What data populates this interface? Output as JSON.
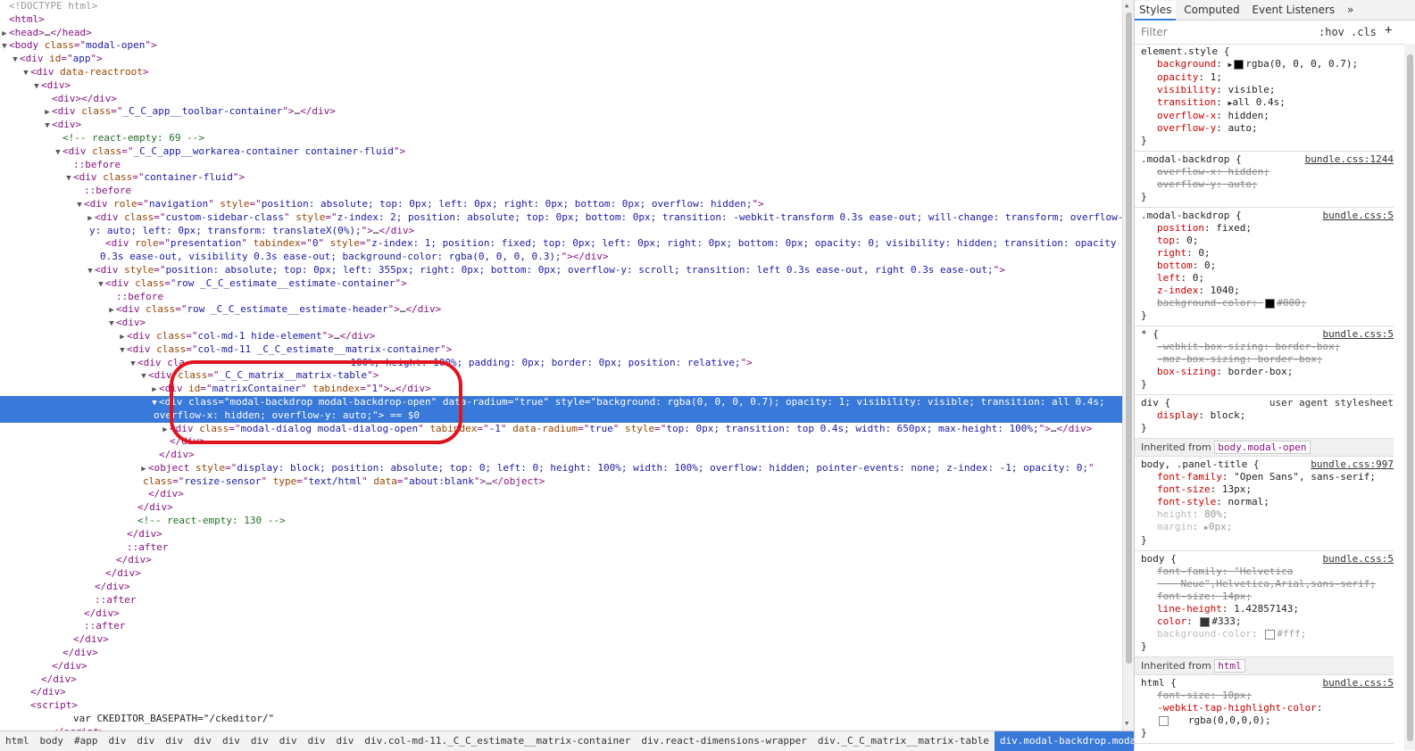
{
  "dom_lines": [
    {
      "indent": 0,
      "tri": "",
      "html": "<span class='dim'>&lt;!DOCTYPE html&gt;</span>"
    },
    {
      "indent": 0,
      "tri": "",
      "html": "<span class='tag'>&lt;html&gt;</span>"
    },
    {
      "indent": 0,
      "tri": "▶",
      "html": "<span class='tag'>&lt;head&gt;</span>…<span class='tag'>&lt;/head&gt;</span>"
    },
    {
      "indent": 0,
      "tri": "▼",
      "html": "<span class='tag'>&lt;body </span><span class='attr'>class</span><span class='tag'>=\"</span><span class='val'>modal-open</span><span class='tag'>\"&gt;</span>"
    },
    {
      "indent": 1,
      "tri": "▼",
      "html": "<span class='tag'>&lt;div </span><span class='attr'>id</span><span class='tag'>=\"</span><span class='val'>app</span><span class='tag'>\"&gt;</span>"
    },
    {
      "indent": 2,
      "tri": "▼",
      "html": "<span class='tag'>&lt;div </span><span class='attr'>data-reactroot</span><span class='tag'>&gt;</span>"
    },
    {
      "indent": 3,
      "tri": "▼",
      "html": "<span class='tag'>&lt;div&gt;</span>"
    },
    {
      "indent": 4,
      "tri": "",
      "html": "<span class='tag'>&lt;div&gt;&lt;/div&gt;</span>"
    },
    {
      "indent": 4,
      "tri": "▶",
      "html": "<span class='tag'>&lt;div </span><span class='attr'>class</span><span class='tag'>=\"</span><span class='val'>_C_C_app__toolbar-container</span><span class='tag'>\"&gt;</span>…<span class='tag'>&lt;/div&gt;</span>"
    },
    {
      "indent": 4,
      "tri": "▼",
      "html": "<span class='tag'>&lt;div&gt;</span>"
    },
    {
      "indent": 5,
      "tri": "",
      "html": "<span class='cmt'>&lt;!-- react-empty: 69 --&gt;</span>"
    },
    {
      "indent": 5,
      "tri": "▼",
      "html": "<span class='tag'>&lt;div </span><span class='attr'>class</span><span class='tag'>=\"</span><span class='val'>_C_C_app__workarea-container container-fluid</span><span class='tag'>\"&gt;</span>"
    },
    {
      "indent": 6,
      "tri": "",
      "html": "<span class='pseudo'>::before</span>"
    },
    {
      "indent": 6,
      "tri": "▼",
      "html": "<span class='tag'>&lt;div </span><span class='attr'>class</span><span class='tag'>=\"</span><span class='val'>container-fluid</span><span class='tag'>\"&gt;</span>"
    },
    {
      "indent": 7,
      "tri": "",
      "html": "<span class='pseudo'>::before</span>"
    },
    {
      "indent": 7,
      "tri": "▼",
      "html": "<span class='tag'>&lt;div </span><span class='attr'>role</span><span class='tag'>=\"</span><span class='val'>navigation</span><span class='tag'>\" </span><span class='attr'>style</span><span class='tag'>=\"</span><span class='val'>position: absolute; top: 0px; left: 0px; right: 0px; bottom: 0px; overflow: hidden;</span><span class='tag'>\"&gt;</span>"
    },
    {
      "indent": 8,
      "tri": "▶",
      "html": "<span class='tag'>&lt;div </span><span class='attr'>class</span><span class='tag'>=\"</span><span class='val'>custom-sidebar-class</span><span class='tag'>\" </span><span class='attr'>style</span><span class='tag'>=\"</span><span class='val'>z-index: 2; position: absolute; top: 0px; bottom: 0px; transition: -webkit-transform 0.3s ease-out; will-change: transform; overflow-</span>"
    },
    {
      "indent": 8,
      "tri": "",
      "cont": true,
      "html": "<span class='val'>y: auto; left: 0px; transform: translateX(0%);</span><span class='tag'>\"&gt;</span>…<span class='tag'>&lt;/div&gt;</span>"
    },
    {
      "indent": 9,
      "tri": "",
      "html": "<span class='tag'>&lt;div </span><span class='attr'>role</span><span class='tag'>=\"</span><span class='val'>presentation</span><span class='tag'>\" </span><span class='attr'>tabindex</span><span class='tag'>=\"</span><span class='val'>0</span><span class='tag'>\" </span><span class='attr'>style</span><span class='tag'>=\"</span><span class='val'>z-index: 1; position: fixed; top: 0px; left: 0px; right: 0px; bottom: 0px; opacity: 0; visibility: hidden; transition: opacity</span>"
    },
    {
      "indent": 9,
      "tri": "",
      "cont": true,
      "html": "<span class='val'>0.3s ease-out, visibility 0.3s ease-out; background-color: rgba(0, 0, 0, 0.3);</span><span class='tag'>\"&gt;&lt;/div&gt;</span>"
    },
    {
      "indent": 8,
      "tri": "▼",
      "html": "<span class='tag'>&lt;div </span><span class='attr'>style</span><span class='tag'>=\"</span><span class='val'>position: absolute; top: 0px; left: 355px; right: 0px; bottom: 0px; overflow-y: scroll; transition: left 0.3s ease-out, right 0.3s ease-out;</span><span class='tag'>\"&gt;</span>"
    },
    {
      "indent": 9,
      "tri": "▼",
      "html": "<span class='tag'>&lt;div </span><span class='attr'>class</span><span class='tag'>=\"</span><span class='val'>row _C_C_estimate__estimate-container</span><span class='tag'>\"&gt;</span>"
    },
    {
      "indent": 10,
      "tri": "",
      "html": "<span class='pseudo'>::before</span>"
    },
    {
      "indent": 10,
      "tri": "▶",
      "html": "<span class='tag'>&lt;div </span><span class='attr'>class</span><span class='tag'>=\"</span><span class='val'>row _C_C_estimate__estimate-header</span><span class='tag'>\"&gt;</span>…<span class='tag'>&lt;/div&gt;</span>"
    },
    {
      "indent": 10,
      "tri": "▼",
      "html": "<span class='tag'>&lt;div&gt;</span>"
    },
    {
      "indent": 11,
      "tri": "▶",
      "html": "<span class='tag'>&lt;div </span><span class='attr'>class</span><span class='tag'>=\"</span><span class='val'>col-md-1 hide-element</span><span class='tag'>\"&gt;</span>…<span class='tag'>&lt;/div&gt;</span>"
    },
    {
      "indent": 11,
      "tri": "▼",
      "html": "<span class='tag'>&lt;div </span><span class='attr'>class</span><span class='tag'>=\"</span><span class='val'>col-md-11 _C_C_estimate__matrix-container</span><span class='tag'>\"&gt;</span>"
    },
    {
      "indent": 12,
      "tri": "▼",
      "html": "<span class='tag'>&lt;div cla</span>                            <span class='val'>100%; height: 100%; padding: 0px; border: 0px; position: relative;</span><span class='tag'>\"&gt;</span>"
    },
    {
      "indent": 13,
      "tri": "▼",
      "html": "<span class='tag'>&lt;div </span><span class='attr'>class</span><span class='tag'>=\"</span><span class='val'>_C_C_matrix__matrix-table</span><span class='tag'>\"&gt;</span>"
    },
    {
      "indent": 14,
      "tri": "▶",
      "html": "<span class='tag'>&lt;div </span><span class='attr'>id</span><span class='tag'>=\"</span><span class='val'>matrixContainer</span><span class='tag'>\" </span><span class='attr'>tabindex</span><span class='tag'>=\"</span><span class='val'>1</span><span class='tag'>\"&gt;</span>…<span class='tag'>&lt;/div&gt;</span>"
    },
    {
      "indent": 14,
      "tri": "▼",
      "selected": true,
      "html": "<span>&lt;div class=\"modal-backdrop modal-backdrop-open\" data-radium=\"true\" style=\"background: rgba(0, 0, 0, 0.7); opacity: 1; visibility: visible; transition: all 0.4s;</span>"
    },
    {
      "indent": 14,
      "tri": "",
      "cont": true,
      "selected": true,
      "html": "<span>overflow-x: hidden; overflow-y: auto;\"&gt; == $0</span>"
    },
    {
      "indent": 15,
      "tri": "▶",
      "html": "<span class='tag'>&lt;div </span><span class='attr'>class</span><span class='tag'>=\"</span><span class='val'>modal-dialog modal-dialog-open</span><span class='tag'>\" </span><span class='attr'>tabindex</span><span class='tag'>=\"</span><span class='val'>-1</span><span class='tag'>\" </span><span class='attr'>data-radium</span><span class='tag'>=\"</span><span class='val'>true</span><span class='tag'>\" </span><span class='attr'>style</span><span class='tag'>=\"</span><span class='val'>top: 0px; transition: top 0.4s; width: 650px; max-height: 100%;</span><span class='tag'>\"&gt;</span>…<span class='tag'>&lt;/div&gt;</span>"
    },
    {
      "indent": 15,
      "tri": "",
      "html": "<span class='tag'>&lt;/div&gt;</span>"
    },
    {
      "indent": 14,
      "tri": "",
      "html": "<span class='tag'>&lt;/div&gt;</span>"
    },
    {
      "indent": 13,
      "tri": "▶",
      "html": "<span class='tag'>&lt;object </span><span class='attr'>style</span><span class='tag'>=\"</span><span class='val'>display: block; position: absolute; top: 0; left: 0; height: 100%; width: 100%; overflow: hidden; pointer-events: none; z-index: -1; opacity: 0;</span><span class='tag'>\"</span>"
    },
    {
      "indent": 13,
      "tri": "",
      "cont": true,
      "html": "<span class='attr'>class</span><span class='tag'>=\"</span><span class='val'>resize-sensor</span><span class='tag'>\" </span><span class='attr'>type</span><span class='tag'>=\"</span><span class='val'>text/html</span><span class='tag'>\" </span><span class='attr'>data</span><span class='tag'>=\"</span><span class='val'>about:blank</span><span class='tag'>\"&gt;</span>…<span class='tag'>&lt;/object&gt;</span>"
    },
    {
      "indent": 13,
      "tri": "",
      "html": "<span class='tag'>&lt;/div&gt;</span>"
    },
    {
      "indent": 12,
      "tri": "",
      "html": "<span class='tag'>&lt;/div&gt;</span>"
    },
    {
      "indent": 12,
      "tri": "",
      "html": "<span class='cmt'>&lt;!-- react-empty: 130 --&gt;</span>"
    },
    {
      "indent": 11,
      "tri": "",
      "html": "<span class='tag'>&lt;/div&gt;</span>"
    },
    {
      "indent": 11,
      "tri": "",
      "html": "<span class='pseudo'>::after</span>"
    },
    {
      "indent": 10,
      "tri": "",
      "html": "<span class='tag'>&lt;/div&gt;</span>"
    },
    {
      "indent": 9,
      "tri": "",
      "html": "<span class='tag'>&lt;/div&gt;</span>"
    },
    {
      "indent": 8,
      "tri": "",
      "html": "<span class='tag'>&lt;/div&gt;</span>"
    },
    {
      "indent": 8,
      "tri": "",
      "html": "<span class='pseudo'>::after</span>"
    },
    {
      "indent": 7,
      "tri": "",
      "html": "<span class='tag'>&lt;/div&gt;</span>"
    },
    {
      "indent": 7,
      "tri": "",
      "html": "<span class='pseudo'>::after</span>"
    },
    {
      "indent": 6,
      "tri": "",
      "html": "<span class='tag'>&lt;/div&gt;</span>"
    },
    {
      "indent": 5,
      "tri": "",
      "html": "<span class='tag'>&lt;/div&gt;</span>"
    },
    {
      "indent": 4,
      "tri": "",
      "html": "<span class='tag'>&lt;/div&gt;</span>"
    },
    {
      "indent": 3,
      "tri": "",
      "html": "<span class='tag'>&lt;/div&gt;</span>"
    },
    {
      "indent": 2,
      "tri": "",
      "html": "<span class='tag'>&lt;/div&gt;</span>"
    },
    {
      "indent": 2,
      "tri": "",
      "html": "<span class='tag'>&lt;script&gt;</span>"
    },
    {
      "indent": 6,
      "tri": "",
      "html": "<span class='txt'>var CKEDITOR_BASEPATH=\"/ckeditor/\"</span>"
    },
    {
      "indent": 4,
      "tri": "",
      "html": "<span class='tag'>&lt;/script&gt;</span>"
    }
  ],
  "breadcrumbs": [
    "html",
    "body",
    "#app",
    "div",
    "div",
    "div",
    "div",
    "div",
    "div",
    "div",
    "div",
    "div",
    "div.col-md-11._C_C_estimate__matrix-container",
    "div.react-dimensions-wrapper",
    "div._C_C_matrix__matrix-table",
    "div.modal-backdrop.modal-backdrop-open"
  ],
  "styles": {
    "tabs": [
      "Styles",
      "Computed",
      "Event Listeners",
      "»"
    ],
    "filter_placeholder": "Filter",
    "hov": ":hov",
    "cls": ".cls",
    "add": "+"
  },
  "rules": [
    {
      "selector": "element.style {",
      "source": "",
      "decls": [
        {
          "p": "background",
          "v": "rgba(0, 0, 0, 0.7);",
          "tri": true,
          "swatch": "#000000"
        },
        {
          "p": "opacity",
          "v": "1;"
        },
        {
          "p": "visibility",
          "v": "visible;"
        },
        {
          "p": "transition",
          "v": "all 0.4s;",
          "tri": true
        },
        {
          "p": "overflow-x",
          "v": "hidden;"
        },
        {
          "p": "overflow-y",
          "v": "auto;"
        }
      ]
    },
    {
      "selector": ".modal-backdrop {",
      "source": "bundle.css:1244",
      "decls": [
        {
          "p": "overflow-x",
          "v": "hidden;",
          "state": "struck"
        },
        {
          "p": "overflow-y",
          "v": "auto;",
          "state": "struck"
        }
      ]
    },
    {
      "selector": ".modal-backdrop {",
      "source": "bundle.css:5",
      "decls": [
        {
          "p": "position",
          "v": "fixed;"
        },
        {
          "p": "top",
          "v": "0;"
        },
        {
          "p": "right",
          "v": "0;"
        },
        {
          "p": "bottom",
          "v": "0;"
        },
        {
          "p": "left",
          "v": "0;"
        },
        {
          "p": "z-index",
          "v": "1040;"
        },
        {
          "p": "background-color",
          "v": "#000;",
          "state": "struck",
          "swatch": "#000000"
        }
      ]
    },
    {
      "selector": "* {",
      "source": "bundle.css:5",
      "decls": [
        {
          "p": "-webkit-box-sizing",
          "v": "border-box;",
          "state": "struck"
        },
        {
          "p": "-moz-box-sizing",
          "v": "border-box;",
          "state": "struck"
        },
        {
          "p": "box-sizing",
          "v": "border-box;"
        }
      ]
    },
    {
      "selector": "div {",
      "source": "user agent stylesheet",
      "ua": true,
      "decls": [
        {
          "p": "display",
          "v": "block;"
        }
      ]
    },
    {
      "inherited": "Inherited from",
      "node": "body.modal-open"
    },
    {
      "selector": "body, .panel-title {",
      "source": "bundle.css:997",
      "decls": [
        {
          "p": "font-family",
          "v": "\"Open Sans\", sans-serif;"
        },
        {
          "p": "font-size",
          "v": "13px;"
        },
        {
          "p": "font-style",
          "v": "normal;"
        },
        {
          "p": "height",
          "v": "80%;",
          "state": "inactive"
        },
        {
          "p": "margin",
          "v": "0px;",
          "state": "inactive",
          "tri": true
        }
      ]
    },
    {
      "selector": "body {",
      "source": "bundle.css:5",
      "decls": [
        {
          "p": "font-family",
          "v": "\"Helvetica",
          "state": "struck"
        },
        {
          "p": "",
          "v": "    Neue\",Helvetica,Arial,sans-serif;",
          "state": "struck"
        },
        {
          "p": "font-size",
          "v": "14px;",
          "state": "struck"
        },
        {
          "p": "line-height",
          "v": "1.42857143;"
        },
        {
          "p": "color",
          "v": "#333;",
          "swatch": "#333333"
        },
        {
          "p": "background-color",
          "v": "#fff;",
          "state": "inactive",
          "swatch": "#ffffff"
        }
      ]
    },
    {
      "inherited": "Inherited from",
      "node": "html"
    },
    {
      "selector": "html {",
      "source": "bundle.css:5",
      "decls": [
        {
          "p": "font-size",
          "v": "10px;",
          "state": "struck"
        },
        {
          "p": "-webkit-tap-highlight-color",
          "v": ""
        },
        {
          "p": "",
          "v": "   rgba(0,0,0,0);",
          "swatch": "#ffffff"
        }
      ]
    }
  ]
}
